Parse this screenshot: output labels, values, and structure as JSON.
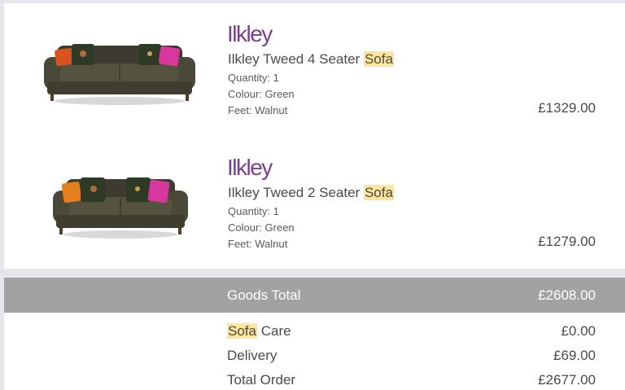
{
  "basket": {
    "items": [
      {
        "brand": "Ilkley",
        "name_prefix": "Ilkley Tweed 4 Seater ",
        "name_highlight": "Sofa",
        "quantity": "Quantity: 1",
        "colour": "Colour: Green",
        "feet": "Feet: Walnut",
        "price": "£1329.00",
        "image": "four-seater-sofa-image"
      },
      {
        "brand": "Ilkley",
        "name_prefix": "Ilkley Tweed 2 Seater ",
        "name_highlight": "Sofa",
        "quantity": "Quantity: 1",
        "colour": "Colour: Green",
        "feet": "Feet: Walnut",
        "price": "£1279.00",
        "image": "two-seater-sofa-image"
      }
    ]
  },
  "totals": {
    "goods_label": "Goods Total",
    "goods_value": "£2608.00",
    "care_highlight": "Sofa",
    "care_suffix": " Care",
    "care_value": "£0.00",
    "delivery_label": "Delivery",
    "delivery_value": "£69.00",
    "order_label": "Total Order",
    "order_value": "£2677.00"
  },
  "colors": {
    "brand": "#7b3e8f",
    "highlight": "#fde59b",
    "goods_bar": "#a2a2a2"
  }
}
